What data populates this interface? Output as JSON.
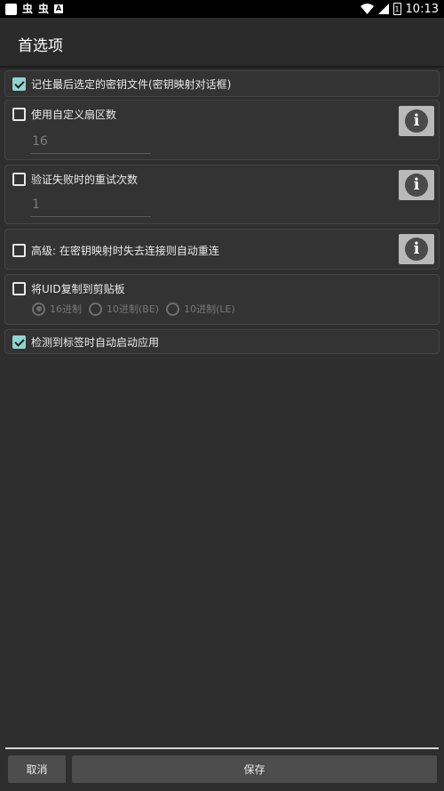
{
  "status_bar": {
    "left_glyphs": [
      "虫",
      "虫"
    ],
    "a_badge": "A",
    "time": "10:13",
    "battery_level": "1"
  },
  "appbar": {
    "title": "首选项"
  },
  "prefs": {
    "remember_key": {
      "label": "记住最后选定的密钥文件(密钥映射对话框)",
      "checked": true
    },
    "custom_sector": {
      "label": "使用自定义扇区数",
      "checked": false,
      "value": "16"
    },
    "retry": {
      "label": "验证失败时的重试次数",
      "checked": false,
      "value": "1"
    },
    "reconnect": {
      "label": "高级: 在密钥映射时失去连接则自动重连",
      "checked": false
    },
    "copy_uid": {
      "label": "将UID复制到剪贴板",
      "checked": false,
      "options": [
        {
          "label": "16进制",
          "selected": true
        },
        {
          "label": "10进制(BE)",
          "selected": false
        },
        {
          "label": "10进制(LE)",
          "selected": false
        }
      ]
    },
    "auto_start": {
      "label": "检测到标签时自动启动应用",
      "checked": true
    }
  },
  "info_icon_glyph": "i",
  "buttons": {
    "cancel": "取消",
    "save": "保存"
  },
  "colors": {
    "accent": "#8fd5cf",
    "background": "#2e2e2e",
    "button": "#4d4d4d"
  }
}
